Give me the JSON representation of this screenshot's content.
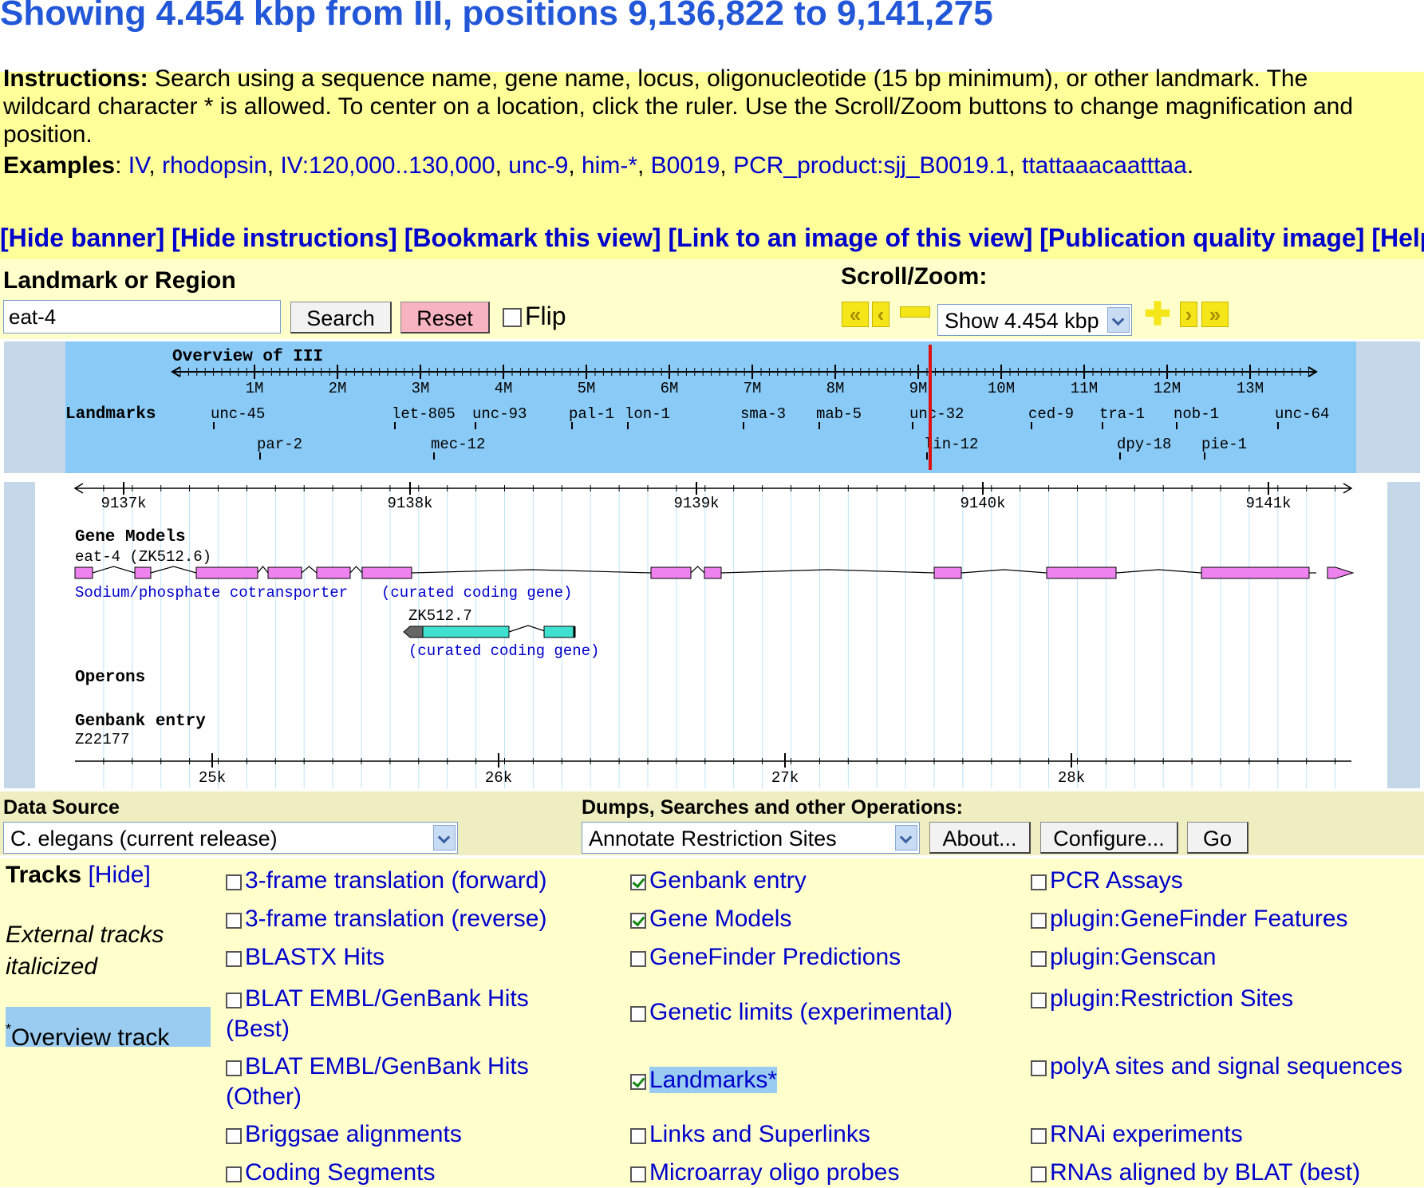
{
  "header": {
    "title": "Showing 4.454 kbp from III, positions 9,136,822 to 9,141,275"
  },
  "instructions": {
    "label": "Instructions:",
    "line1": "Search using a sequence name, gene name, locus, oligonucleotide (15 bp minimum), or other landmark. The",
    "line2": "wildcard character * is allowed. To center on a location, click the ruler. Use the Scroll/Zoom buttons to change magnification and",
    "line3": "position.",
    "examples_label": "Examples",
    "examples": [
      "IV",
      "rhodopsin",
      "IV:120,000..130,000",
      "unc-9",
      "him-*",
      "B0019",
      "PCR_product:sjj_B0019.1",
      "ttattaaacaatttaa"
    ]
  },
  "nav_links": [
    "[Hide banner]",
    "[Hide instructions]",
    "[Bookmark this view]",
    "[Link to an image of this view]",
    "[Publication quality image]",
    "[Help]"
  ],
  "search": {
    "label": "Landmark or Region",
    "value": "eat-4",
    "search_button": "Search",
    "reset_button": "Reset",
    "flip_label": "Flip",
    "scroll_label": "Scroll/Zoom:",
    "zoom_value": "Show 4.454 kbp"
  },
  "overview": {
    "title": "Overview of III",
    "ticks": [
      "1M",
      "2M",
      "3M",
      "4M",
      "5M",
      "6M",
      "7M",
      "8M",
      "9M",
      "10M",
      "11M",
      "12M",
      "13M"
    ],
    "landmarks_label": "Landmarks",
    "landmarks_row1": [
      "unc-45",
      "let-805",
      "unc-93",
      "pal-1",
      "lon-1",
      "sma-3",
      "mab-5",
      "unc-32",
      "ced-9",
      "tra-1",
      "nob-1",
      "unc-64"
    ],
    "landmarks_row2": [
      "par-2",
      "mec-12",
      "lin-12",
      "dpy-18",
      "pie-1"
    ]
  },
  "detail": {
    "top_ticks": [
      "9137k",
      "9138k",
      "9139k",
      "9140k",
      "9141k"
    ],
    "gene_models_label": "Gene Models",
    "gene1_name": "eat-4 (ZK512.6)",
    "gene1_desc": "Sodium/phosphate cotransporter",
    "gene1_type": "(curated coding gene)",
    "gene2_name": "ZK512.7",
    "gene2_type": "(curated coding gene)",
    "operons_label": "Operons",
    "genbank_label": "Genbank entry",
    "genbank_id": "Z22177",
    "bottom_ticks": [
      "25k",
      "26k",
      "27k",
      "28k"
    ]
  },
  "datasource": {
    "label": "Data Source",
    "value": "C. elegans (current release)",
    "ops_label": "Dumps, Searches and other Operations:",
    "ops_value": "Annotate Restriction Sites",
    "about_button": "About...",
    "configure_button": "Configure...",
    "go_button": "Go"
  },
  "tracks": {
    "label": "Tracks",
    "hide_link": "[Hide]",
    "external_note": "External tracks italicized",
    "overview_note": "Overview track",
    "col1": [
      {
        "label": "3-frame translation (forward)",
        "checked": false
      },
      {
        "label": "3-frame translation (reverse)",
        "checked": false
      },
      {
        "label": "BLASTX Hits",
        "checked": false
      },
      {
        "label": "BLAT EMBL/GenBank Hits (Best)",
        "checked": false
      },
      {
        "label": "BLAT EMBL/GenBank Hits (Other)",
        "checked": false
      },
      {
        "label": "Briggsae alignments",
        "checked": false
      },
      {
        "label": "Coding Segments",
        "checked": false
      }
    ],
    "col2": [
      {
        "label": "Genbank entry",
        "checked": true
      },
      {
        "label": "Gene Models",
        "checked": true
      },
      {
        "label": "GeneFinder Predictions",
        "checked": false
      },
      {
        "label": "Genetic limits (experimental)",
        "checked": false
      },
      {
        "label": "Landmarks*",
        "checked": true
      },
      {
        "label": "Links and Superlinks",
        "checked": false
      },
      {
        "label": "Microarray oligo probes",
        "checked": false
      }
    ],
    "col3": [
      {
        "label": "PCR Assays",
        "checked": false
      },
      {
        "label": "plugin:GeneFinder Features",
        "checked": false
      },
      {
        "label": "plugin:Genscan",
        "checked": false
      },
      {
        "label": "plugin:Restriction Sites",
        "checked": false
      },
      {
        "label": "polyA sites and signal sequences",
        "checked": false
      },
      {
        "label": "RNAi experiments",
        "checked": false
      },
      {
        "label": "RNAs aligned by BLAT (best)",
        "checked": false
      }
    ]
  }
}
